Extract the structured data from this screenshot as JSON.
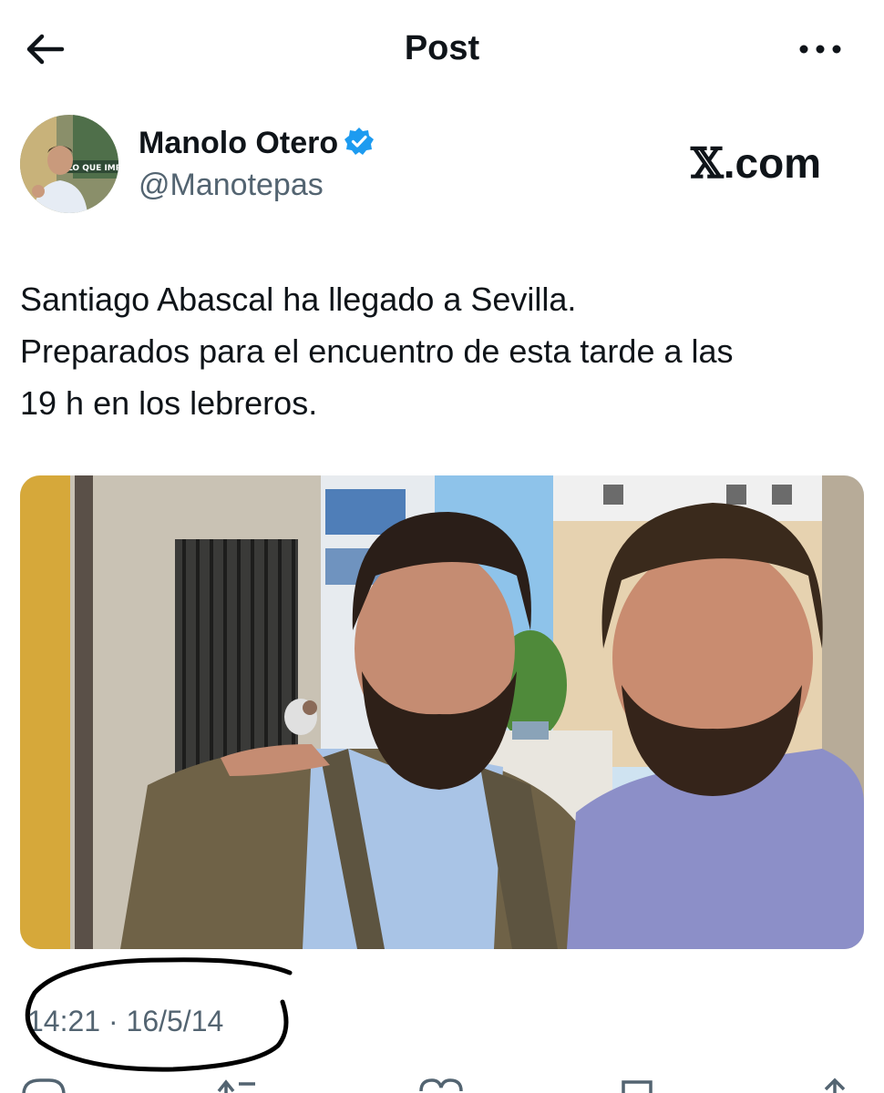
{
  "header": {
    "title": "Post",
    "back_icon": "arrow-left-icon",
    "more_icon": "more-horizontal-icon"
  },
  "author": {
    "name": "Manolo Otero",
    "handle": "@Manotepas",
    "verified": true,
    "avatar_banner_text": "LO QUE IMPO",
    "verified_color": "#1d9bf0"
  },
  "site_logo": {
    "glyph": "𝕏",
    "text": ".com"
  },
  "post": {
    "lines": [
      "Santiago Abascal ha llegado a Sevilla.",
      "Preparados para el encuentro de esta tarde a las",
      "19 h en los lebreros."
    ]
  },
  "timestamp": "14:21 · 16/5/14",
  "actions": [
    "reply-icon",
    "repost-icon",
    "like-icon",
    "bookmark-icon",
    "share-icon"
  ],
  "colors": {
    "text_primary": "#0f1419",
    "text_secondary": "#536471",
    "accent": "#1d9bf0"
  }
}
